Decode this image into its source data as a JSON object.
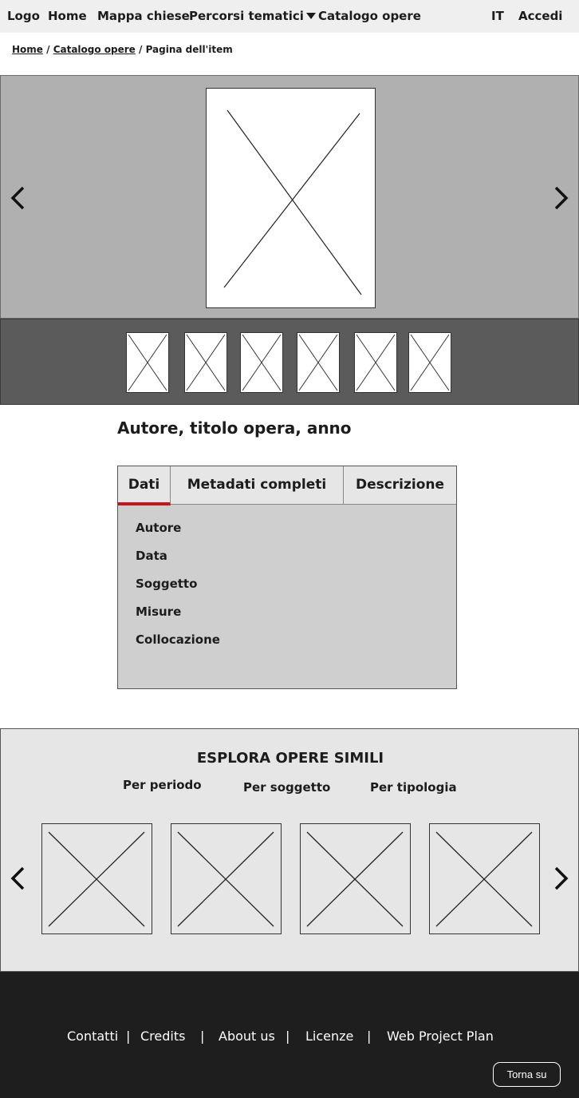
{
  "nav": {
    "logo": "Logo",
    "home": "Home",
    "map": "Mappa chiese",
    "themes": "Percorsi tematici",
    "catalog": "Catalogo opere",
    "lang": "IT",
    "login": "Accedi"
  },
  "breadcrumb": {
    "home": "Home",
    "sep1": " / ",
    "catalog": "Catalogo opere",
    "current": " / Pagina dell'item"
  },
  "item": {
    "title": "Autore, titolo opera, anno"
  },
  "tabs": {
    "items": [
      "Dati",
      "Metadati completi",
      "Descrizione"
    ],
    "active": 0,
    "fields": [
      "Autore",
      "Data",
      "Soggetto",
      "Misure",
      "Collocazione"
    ]
  },
  "similar": {
    "title": "ESPLORA OPERE SIMILI",
    "filters": [
      "Per periodo",
      "Per soggetto",
      "Per tipologia"
    ]
  },
  "footer": {
    "links": [
      "Contatti",
      "Credits",
      "About us",
      "Licenze",
      "Web Project Plan"
    ],
    "separator": "|",
    "back_to_top": "Torna su"
  },
  "colors": {
    "accent": "#c4161c",
    "nav_bg": "#efefef",
    "hero_bg": "#b0b0b0",
    "thumbs_bg": "#5b5b5b",
    "footer_bg": "#1e1e1e"
  }
}
